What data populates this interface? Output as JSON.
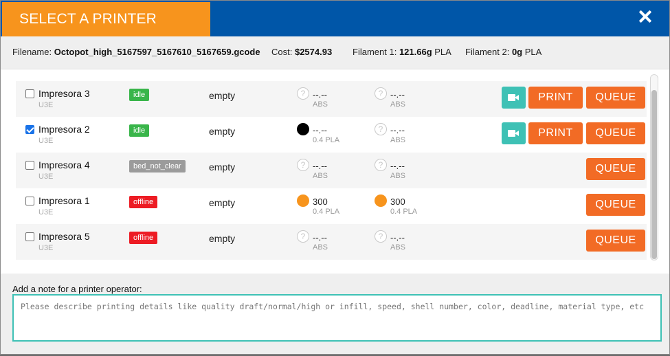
{
  "header": {
    "title": "SELECT A PRINTER"
  },
  "info": {
    "filename_label": "Filename:",
    "filename": "Octopot_high_5167597_5167610_5167659.gcode",
    "cost_label": "Cost:",
    "cost": "$2574.93",
    "filament1_label": "Filament 1:",
    "filament1": "121.66g",
    "filament1_mat": "PLA",
    "filament2_label": "Filament 2:",
    "filament2": "0g",
    "filament2_mat": "PLA"
  },
  "printers": [
    {
      "name": "Impresora 3",
      "model": "U3E",
      "status": "idle",
      "bed": "empty",
      "checked": false,
      "t1": {
        "icon": "question",
        "temp": "--.--",
        "mat": "ABS"
      },
      "t2": {
        "icon": "question",
        "temp": "--.--",
        "mat": "ABS"
      },
      "print": "PRINT",
      "queue": "QUEUE"
    },
    {
      "name": "Impresora 2",
      "model": "U3E",
      "status": "idle",
      "bed": "empty",
      "checked": true,
      "t1": {
        "icon": "black",
        "temp": "--.--",
        "mat": "0.4 PLA"
      },
      "t2": {
        "icon": "question",
        "temp": "--.--",
        "mat": "ABS"
      },
      "print": "PRINT",
      "queue": "QUEUE"
    },
    {
      "name": "Impresora 4",
      "model": "U3E",
      "status": "bed_not_clear",
      "bed": "empty",
      "checked": false,
      "t1": {
        "icon": "question",
        "temp": "--.--",
        "mat": "ABS"
      },
      "t2": {
        "icon": "question",
        "temp": "--.--",
        "mat": "ABS"
      },
      "queue": "QUEUE"
    },
    {
      "name": "Impresora 1",
      "model": "U3E",
      "status": "offline",
      "bed": "empty",
      "checked": false,
      "t1": {
        "icon": "orange",
        "temp": "300",
        "mat": "0.4 PLA"
      },
      "t2": {
        "icon": "orange",
        "temp": "300",
        "mat": "0.4 PLA"
      },
      "queue": "QUEUE"
    },
    {
      "name": "Impresora 5",
      "model": "U3E",
      "status": "offline",
      "bed": "empty",
      "checked": false,
      "t1": {
        "icon": "question",
        "temp": "--.--",
        "mat": "ABS"
      },
      "t2": {
        "icon": "question",
        "temp": "--.--",
        "mat": "ABS"
      },
      "queue": "QUEUE"
    }
  ],
  "note": {
    "label": "Add a note for a printer operator:",
    "placeholder": "Please describe printing details like quality draft/normal/high or infill, speed, shell number, color, deadline, material type, etc"
  },
  "icons": {
    "question": "?"
  },
  "colors": {
    "header_blue": "#0056a8",
    "title_orange": "#f7941d",
    "button_orange": "#f26b25",
    "camera_teal": "#3ec1b5",
    "idle_green": "#39b54a",
    "offline_red": "#ed1c24"
  }
}
